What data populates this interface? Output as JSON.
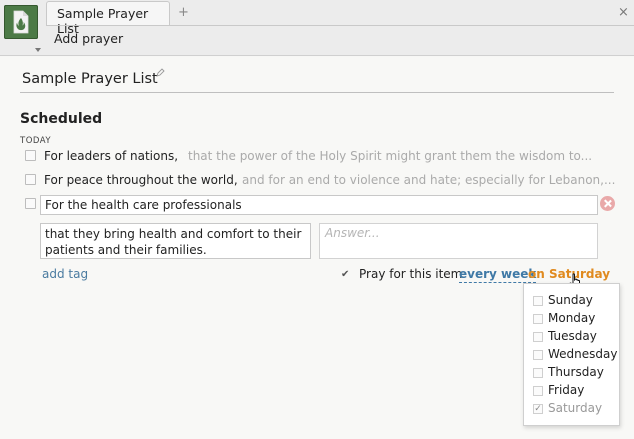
{
  "tabs": [
    {
      "label": "Sample Prayer List"
    }
  ],
  "toolbar": {
    "add_tab_glyph": "+",
    "close_glyph": "×",
    "add_prayer_label": "Add prayer"
  },
  "list": {
    "title": "Sample Prayer List",
    "section_title": "Scheduled",
    "group_label": "TODAY"
  },
  "prayers": [
    {
      "title": "For leaders of nations,",
      "description": "that the power of the Holy Spirit might grant them the wisdom to..."
    },
    {
      "title": "For peace throughout the world,",
      "description": "and for an end to violence and hate; especially for Lebanon,..."
    }
  ],
  "editing": {
    "title_value": "For the health care professionals",
    "description_value": "that they bring health and comfort to their patients and their families.",
    "answer_placeholder": "Answer...",
    "add_tag_label": "add tag",
    "schedule_label": "Pray for this item",
    "schedule_frequency": "every week",
    "schedule_day": "on Saturday",
    "schedule_enabled": true
  },
  "weekday_dropdown": {
    "options": [
      {
        "label": "Sunday",
        "checked": false
      },
      {
        "label": "Monday",
        "checked": false
      },
      {
        "label": "Tuesday",
        "checked": false
      },
      {
        "label": "Wednesday",
        "checked": false
      },
      {
        "label": "Thursday",
        "checked": false
      },
      {
        "label": "Friday",
        "checked": false
      },
      {
        "label": "Saturday",
        "checked": true
      }
    ]
  },
  "colors": {
    "app_icon": "#4c7a46",
    "link_blue": "#3f79a6",
    "accent_orange": "#e08a1e",
    "remove_red": "#e9a9a9"
  },
  "icons": [
    "app-logo-icon",
    "edit-pencil-icon",
    "remove-icon",
    "hand-cursor-icon"
  ]
}
